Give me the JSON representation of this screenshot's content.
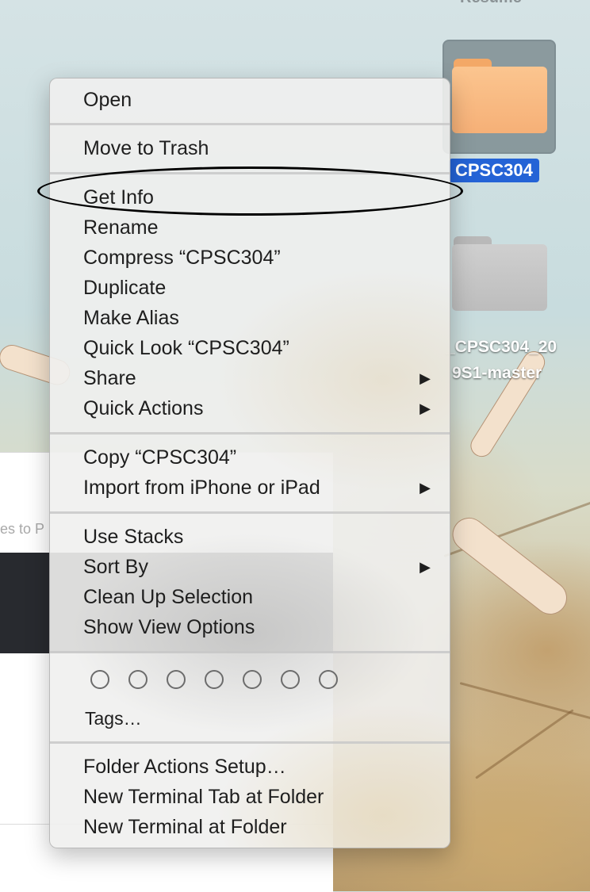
{
  "desktop": {
    "top_partial_label": "Resume",
    "icons": [
      {
        "label": "CPSC304",
        "selected": true,
        "color": "#f6b077"
      },
      {
        "label_line1": "_CPSC304_20",
        "label_line2": "9S1-master",
        "selected": false,
        "color": "#bdbdbd"
      }
    ]
  },
  "side_window": {
    "partial_text": "es to P"
  },
  "context_menu": {
    "sections": [
      [
        {
          "label": "Open"
        }
      ],
      [
        {
          "label": "Move to Trash"
        }
      ],
      [
        {
          "label": "Get Info",
          "highlighted_by_annotation": true
        },
        {
          "label": "Rename"
        },
        {
          "label": "Compress “CPSC304”"
        },
        {
          "label": "Duplicate"
        },
        {
          "label": "Make Alias"
        },
        {
          "label": "Quick Look “CPSC304”"
        },
        {
          "label": "Share",
          "submenu": true
        },
        {
          "label": "Quick Actions",
          "submenu": true
        }
      ],
      [
        {
          "label": "Copy “CPSC304”"
        },
        {
          "label": "Import from iPhone or iPad",
          "submenu": true
        }
      ],
      [
        {
          "label": "Use Stacks"
        },
        {
          "label": "Sort By",
          "submenu": true
        },
        {
          "label": "Clean Up Selection"
        },
        {
          "label": "Show View Options"
        }
      ],
      [
        {
          "label": "Tags…"
        }
      ],
      [
        {
          "label": "Folder Actions Setup…"
        },
        {
          "label": "New Terminal Tab at Folder"
        },
        {
          "label": "New Terminal at Folder"
        }
      ]
    ],
    "submenu_arrow": "▶",
    "tag_colors_count": 7
  },
  "colors": {
    "selection_blue": "#2463d6",
    "menu_text": "#1e1e1e"
  }
}
